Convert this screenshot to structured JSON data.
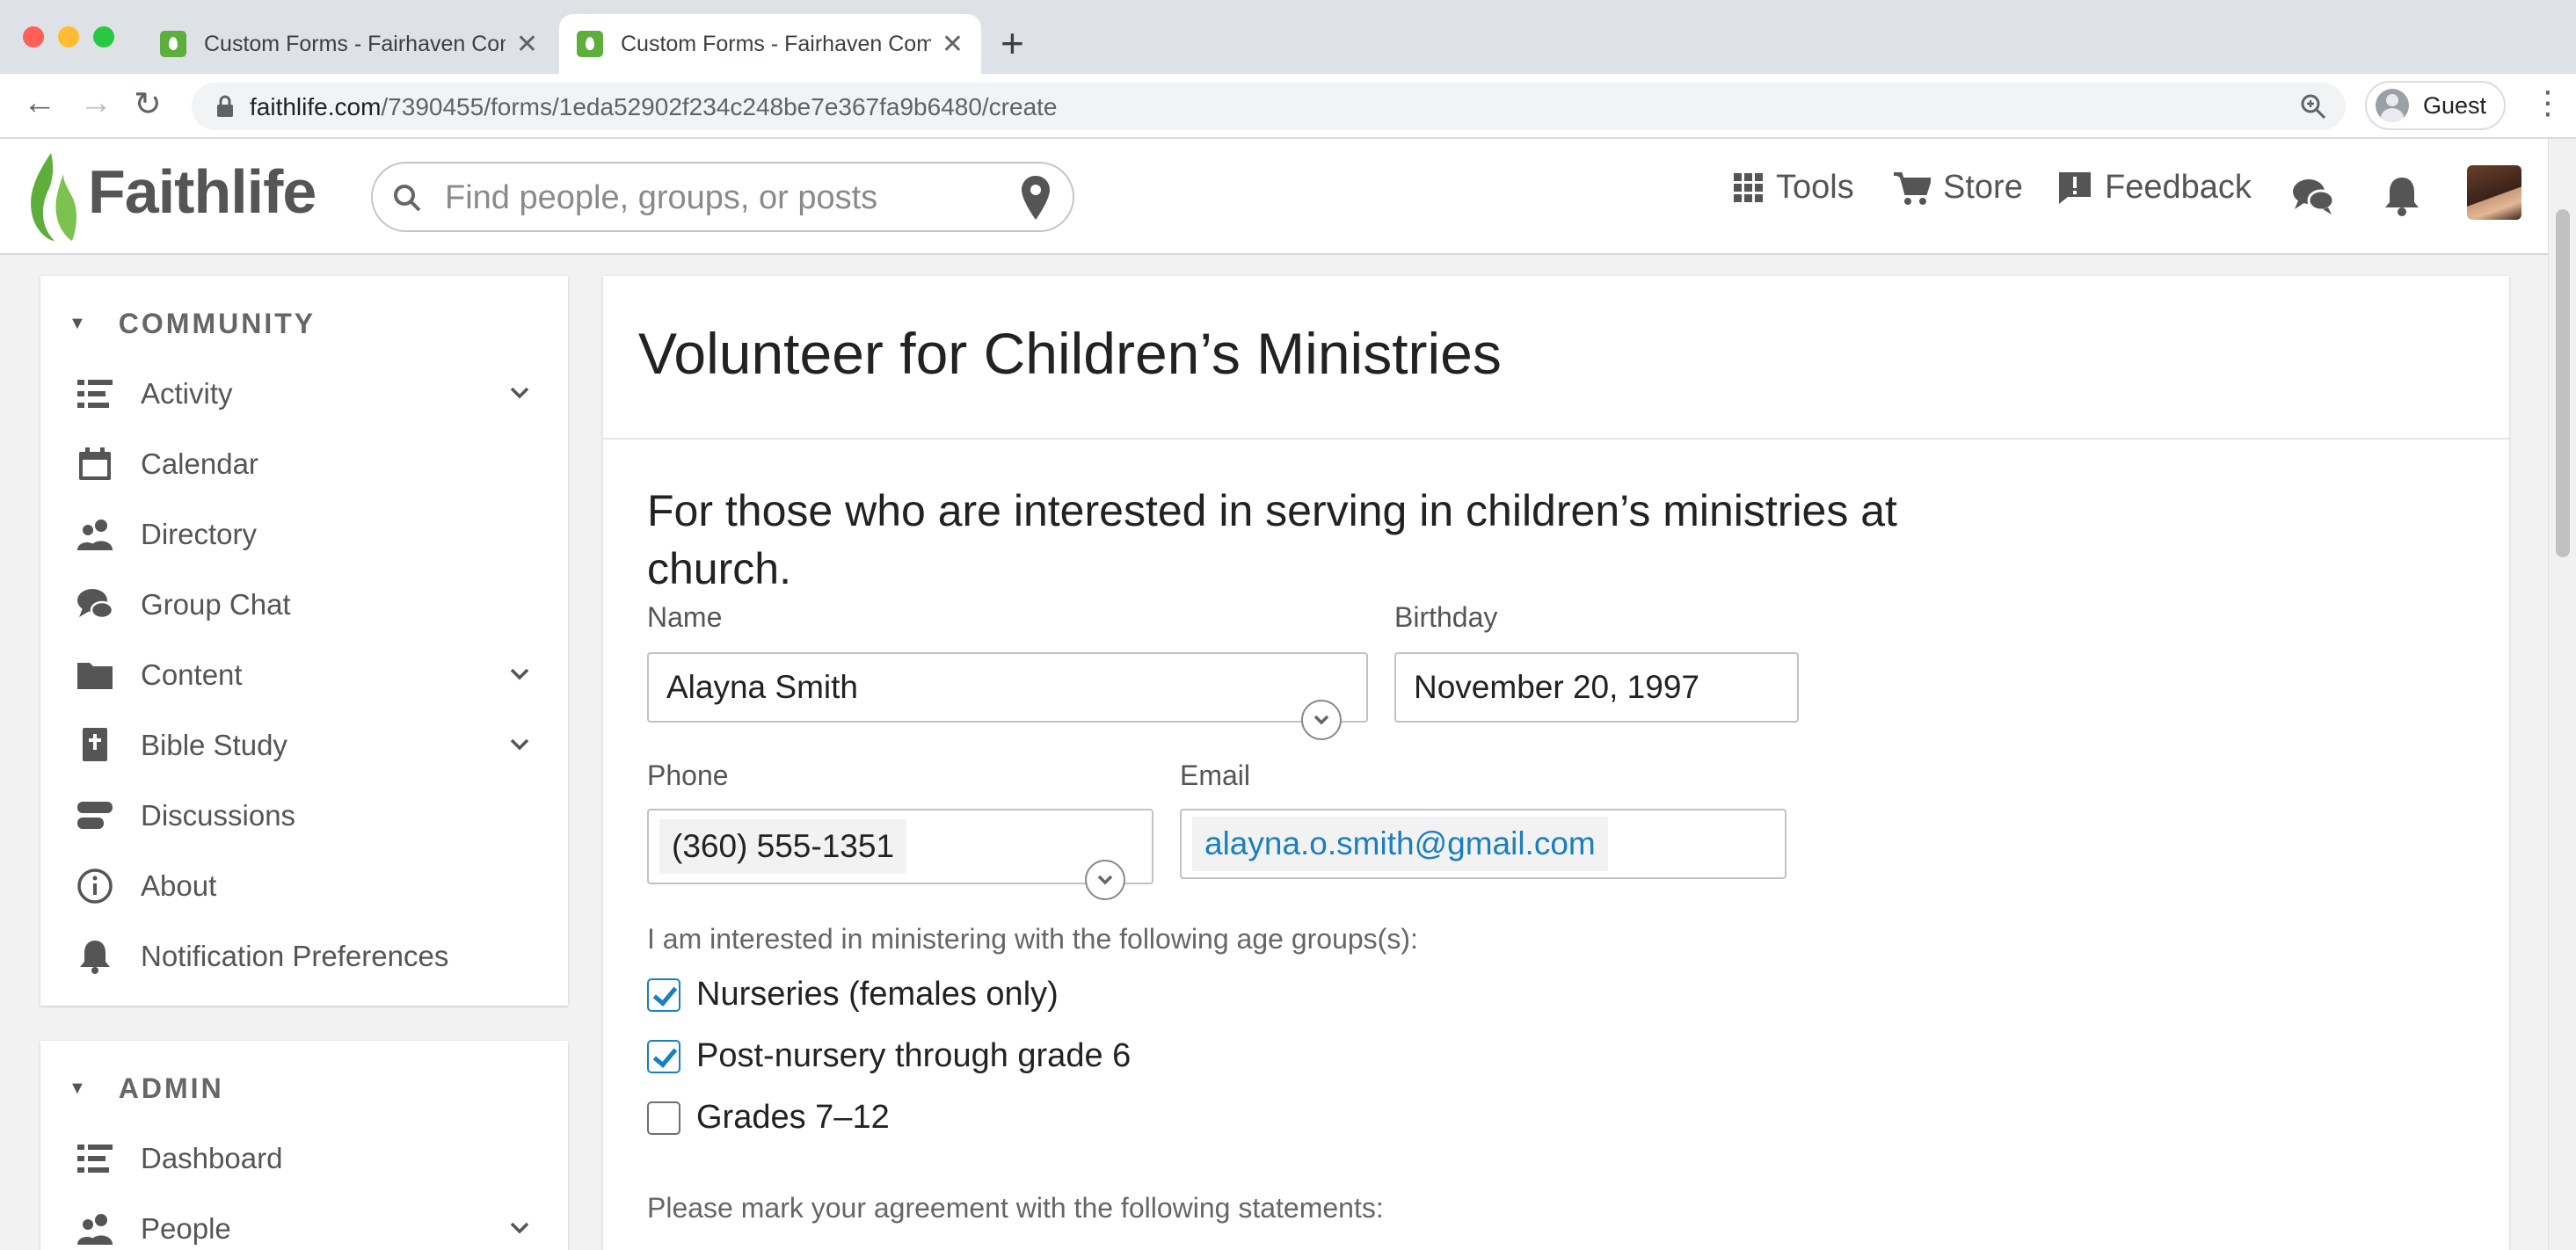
{
  "browser": {
    "tabs": [
      {
        "title": "Custom Forms - Fairhaven Community",
        "close": "✕"
      },
      {
        "title": "Custom Forms - Fairhaven Community",
        "close": "✕"
      }
    ],
    "new_tab": "+",
    "url_host": "faithlife.com",
    "url_path": "/7390455/forms/1eda52902f234c248be7e367fa9b6480/create",
    "profile_label": "Guest",
    "icons": [
      "back-arrow-icon",
      "forward-arrow-icon",
      "reload-icon",
      "lock-icon",
      "zoom-icon",
      "menu-dots-icon"
    ]
  },
  "header": {
    "logo_text": "Faithlife",
    "search_placeholder": "Find people, groups, or posts",
    "nav": [
      {
        "label": "Tools",
        "icon": "grid-icon"
      },
      {
        "label": "Store",
        "icon": "cart-icon"
      },
      {
        "label": "Feedback",
        "icon": "feedback-icon"
      }
    ],
    "accent": "#5dae3b"
  },
  "sidebar": {
    "community_heading": "COMMUNITY",
    "community_items": [
      {
        "label": "Activity",
        "icon": "activity-list-icon",
        "expandable": true
      },
      {
        "label": "Calendar",
        "icon": "calendar-icon",
        "expandable": false
      },
      {
        "label": "Directory",
        "icon": "people-icon",
        "expandable": false
      },
      {
        "label": "Group Chat",
        "icon": "chat-icon",
        "expandable": false
      },
      {
        "label": "Content",
        "icon": "folder-icon",
        "expandable": true
      },
      {
        "label": "Bible Study",
        "icon": "bible-icon",
        "expandable": true
      },
      {
        "label": "Discussions",
        "icon": "discussions-icon",
        "expandable": false
      },
      {
        "label": "About",
        "icon": "info-icon",
        "expandable": false
      },
      {
        "label": "Notification Preferences",
        "icon": "bell-icon",
        "expandable": false
      }
    ],
    "admin_heading": "ADMIN",
    "admin_items": [
      {
        "label": "Dashboard",
        "icon": "dashboard-icon",
        "expandable": false
      },
      {
        "label": "People",
        "icon": "people-icon",
        "expandable": true
      }
    ]
  },
  "form": {
    "title": "Volunteer for Children’s Ministries",
    "description": "For those who are interested in serving in children’s ministries at church.",
    "name_label": "Name",
    "name_value": "Alayna Smith",
    "birthday_label": "Birthday",
    "birthday_value": "November 20, 1997",
    "phone_label": "Phone",
    "phone_value": "(360) 555-1351",
    "email_label": "Email",
    "email_value": "alayna.o.smith@gmail.com",
    "age_question": "I am interested in ministering with the following age groups(s):",
    "age_options": [
      {
        "label": "Nurseries (females only)",
        "checked": true
      },
      {
        "label": "Post-nursery through grade 6",
        "checked": true
      },
      {
        "label": "Grades 7–12",
        "checked": false
      }
    ],
    "agreement_question": "Please mark your agreement with the following statements:",
    "link_color": "#1a7fc1"
  }
}
